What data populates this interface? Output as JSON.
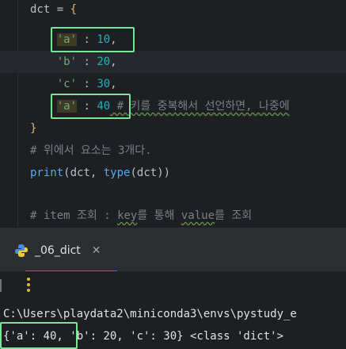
{
  "editor": {
    "lines": [
      {
        "a": "dct",
        "b": " = ",
        "c": "{"
      },
      {
        "indent": "    ",
        "key": "'a'",
        "sep": " : ",
        "val": "10",
        "tail": ","
      },
      {
        "indent": "    ",
        "key": "'b'",
        "sep": " : ",
        "val": "20",
        "tail": ","
      },
      {
        "indent": "    ",
        "key": "'c'",
        "sep": " : ",
        "val": "30",
        "tail": ","
      },
      {
        "indent": "    ",
        "key": "'a'",
        "sep": " : ",
        "val": "40",
        "comment": " # 키를 중복해서 선언하면, 나중에"
      },
      {
        "c": "}"
      },
      {
        "comment": "# 위에서 요소는 3개다."
      },
      {
        "fn1": "print",
        "p1": "(",
        "arg1": "dct, ",
        "fn2": "type",
        "p2": "(",
        "arg2": "dct",
        "p3": "))"
      },
      {
        "text": ""
      },
      {
        "comment": "# item 조회 : ",
        "k1": "key",
        "t1": "를 통해 ",
        "k2": "value",
        "t2": "를 조회"
      }
    ]
  },
  "tool_window": {
    "tab_label": "_06_dict",
    "tab_icon": "python-icon",
    "close_glyph": "✕"
  },
  "console": {
    "path_line": "C:\\Users\\playdata2\\miniconda3\\envs\\pystudy_e",
    "output_line": "{'a': 40, 'b': 20, 'c': 30} <class 'dict'>"
  },
  "colors": {
    "highlight_box": "#7ee39a",
    "accent": "#3574f0"
  }
}
